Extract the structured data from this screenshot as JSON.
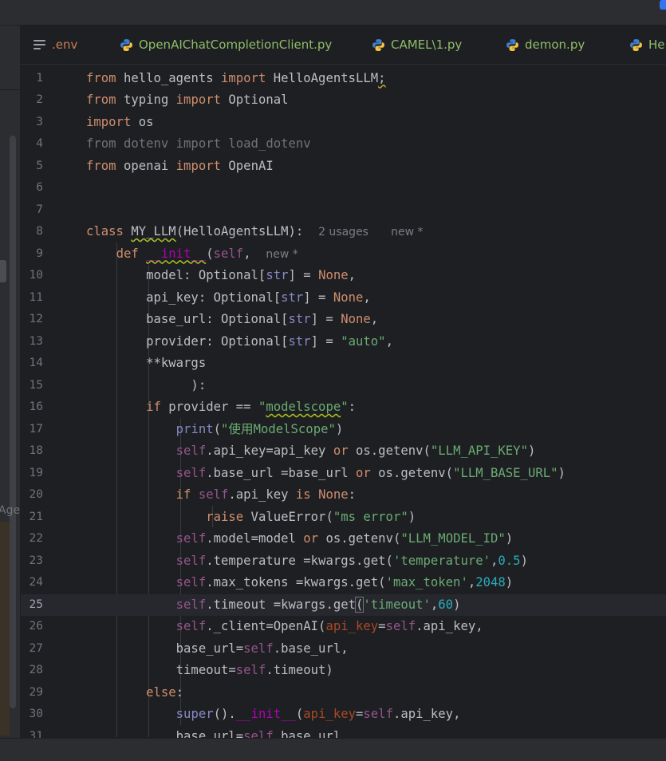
{
  "colors": {
    "background": "#1e1f22",
    "keyword": "#cf8e6d",
    "string": "#6aab73",
    "number": "#2aacb8",
    "self": "#94558d",
    "tab_env": "#c77d55",
    "tab_py": "#8ebd6a"
  },
  "side_panel": {
    "partial_label": "Age"
  },
  "tabs": [
    {
      "label": ".env",
      "icon": "text-file-icon"
    },
    {
      "label": "OpenAIChatCompletionClient.py",
      "icon": "python-icon"
    },
    {
      "label": "CAMEL\\1.py",
      "icon": "python-icon"
    },
    {
      "label": "demon.py",
      "icon": "python-icon"
    },
    {
      "label": "He",
      "icon": "python-icon"
    }
  ],
  "editor": {
    "current_line": 25,
    "hints": {
      "class_usages": "2 usages",
      "class_new": "new *",
      "init_new": "new *"
    },
    "lines": [
      {
        "n": 1,
        "text": "from hello_agents import HelloAgentsLLM;"
      },
      {
        "n": 2,
        "text": "from typing import Optional"
      },
      {
        "n": 3,
        "text": "import os"
      },
      {
        "n": 4,
        "text": "from dotenv import load_dotenv"
      },
      {
        "n": 5,
        "text": "from openai import OpenAI"
      },
      {
        "n": 6,
        "text": ""
      },
      {
        "n": 7,
        "text": ""
      },
      {
        "n": 8,
        "text": "class MY_LLM(HelloAgentsLLM):"
      },
      {
        "n": 9,
        "text": "    def __init__(self,"
      },
      {
        "n": 10,
        "text": "        model: Optional[str] = None,"
      },
      {
        "n": 11,
        "text": "        api_key: Optional[str] = None,"
      },
      {
        "n": 12,
        "text": "        base_url: Optional[str] = None,"
      },
      {
        "n": 13,
        "text": "        provider: Optional[str] = \"auto\","
      },
      {
        "n": 14,
        "text": "        **kwargs"
      },
      {
        "n": 15,
        "text": "              ):"
      },
      {
        "n": 16,
        "text": "        if provider == \"modelscope\":"
      },
      {
        "n": 17,
        "text": "            print(\"使用ModelScope\")"
      },
      {
        "n": 18,
        "text": "            self.api_key=api_key or os.getenv(\"LLM_API_KEY\")"
      },
      {
        "n": 19,
        "text": "            self.base_url =base_url or os.getenv(\"LLM_BASE_URL\")"
      },
      {
        "n": 20,
        "text": "            if self.api_key is None:"
      },
      {
        "n": 21,
        "text": "                raise ValueError(\"ms error\")"
      },
      {
        "n": 22,
        "text": "            self.model=model or os.getenv(\"LLM_MODEL_ID\")"
      },
      {
        "n": 23,
        "text": "            self.temperature =kwargs.get('temperature',0.5)"
      },
      {
        "n": 24,
        "text": "            self.max_tokens =kwargs.get('max_token',2048)"
      },
      {
        "n": 25,
        "text": "            self.timeout =kwargs.get('timeout',60)"
      },
      {
        "n": 26,
        "text": "            self._client=OpenAI(api_key=self.api_key,"
      },
      {
        "n": 27,
        "text": "            base_url=self.base_url,"
      },
      {
        "n": 28,
        "text": "            timeout=self.timeout)"
      },
      {
        "n": 29,
        "text": "        else:"
      },
      {
        "n": 30,
        "text": "            super().__init__(api_key=self.api_key,"
      },
      {
        "n": 31,
        "text": "            base_url=self.base_url,"
      }
    ]
  }
}
